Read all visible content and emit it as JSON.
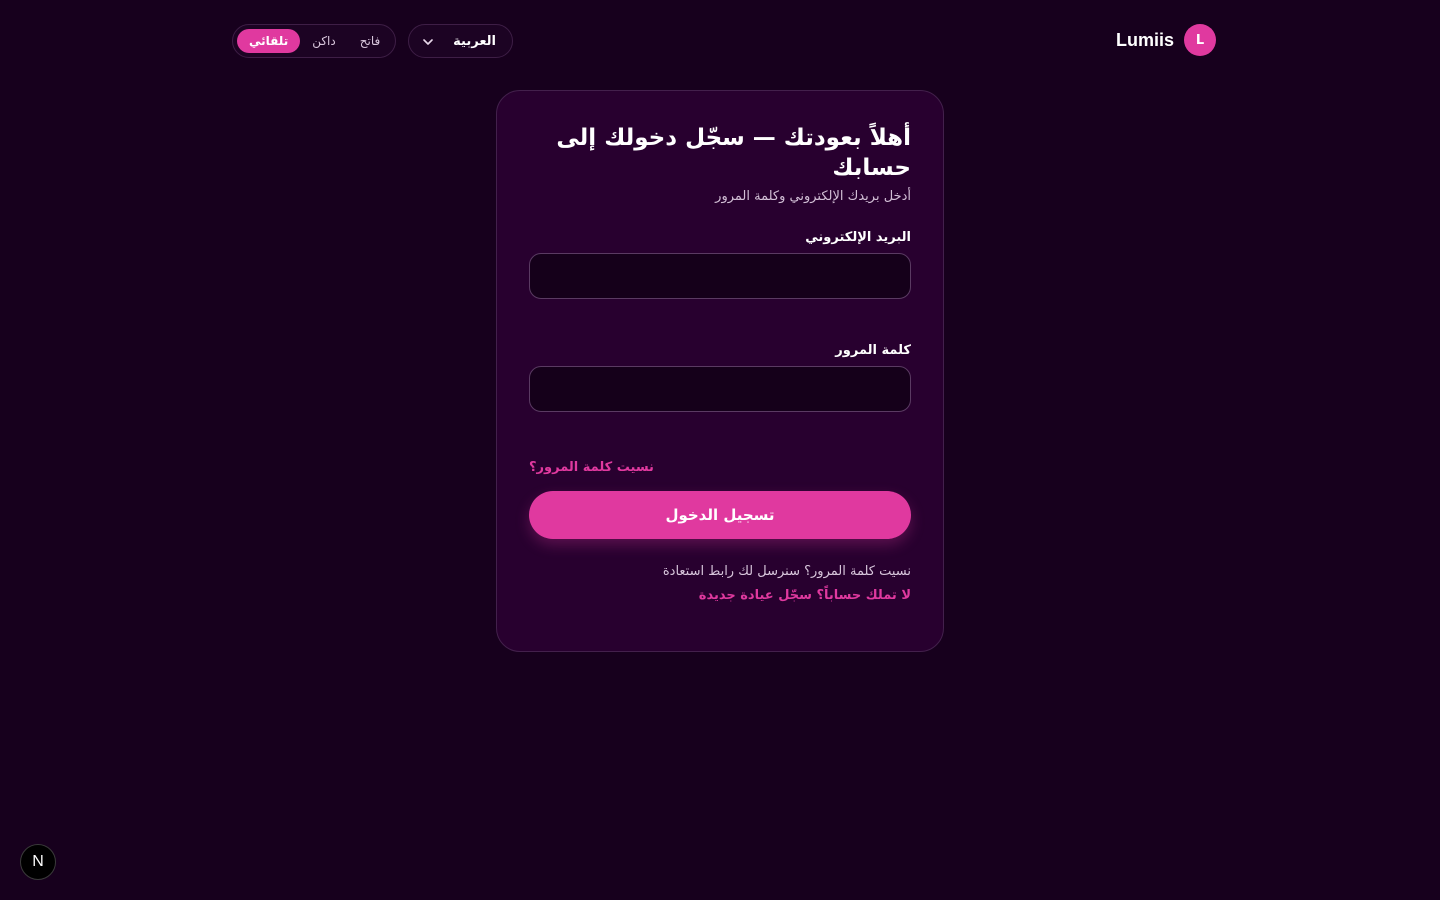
{
  "header": {
    "brand_name": "Lumiis",
    "avatar_letter": "L",
    "language": {
      "selected": "العربية",
      "chevron_icon": "chevron-down-icon"
    },
    "theme_toggle": {
      "options": [
        {
          "key": "light",
          "label": "فاتح"
        },
        {
          "key": "dark",
          "label": "داكن"
        },
        {
          "key": "auto",
          "label": "تلقائي"
        }
      ],
      "active": "auto"
    }
  },
  "login": {
    "title": "أهلاً بعودتك — سجّل دخولك إلى حسابك",
    "subtitle": "أدخل بريدك الإلكتروني وكلمة المرور",
    "email_label": "البريد الإلكتروني",
    "email_value": "",
    "password_label": "كلمة المرور",
    "password_value": "",
    "forgot_link": "نسيت كلمة المرور؟",
    "submit_label": "تسجيل الدخول",
    "help_text": "نسيت كلمة المرور؟ سنرسل لك رابط استعادة",
    "signup_link": "لا تملك حساباً؟ سجّل عيادة جديدة"
  },
  "dev_indicator": {
    "letter": "N"
  },
  "colors": {
    "background": "#17001d",
    "card": "#28002f",
    "accent": "#e0399f",
    "input_bg": "#15001a"
  }
}
